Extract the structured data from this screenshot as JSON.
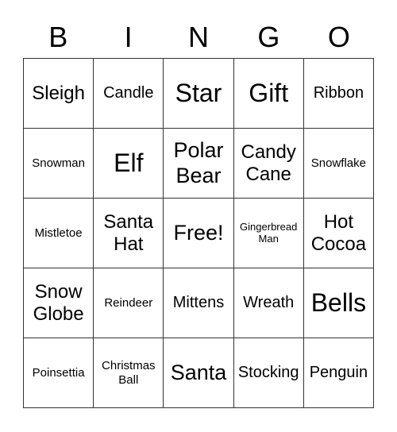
{
  "header": [
    "B",
    "I",
    "N",
    "G",
    "O"
  ],
  "cells": [
    {
      "text": "Sleigh",
      "size": "m"
    },
    {
      "text": "Candle",
      "size": "sm"
    },
    {
      "text": "Star",
      "size": "xl"
    },
    {
      "text": "Gift",
      "size": "xl"
    },
    {
      "text": "Ribbon",
      "size": "sm"
    },
    {
      "text": "Snowman",
      "size": "s"
    },
    {
      "text": "Elf",
      "size": "xl"
    },
    {
      "text": "Polar Bear",
      "size": "l"
    },
    {
      "text": "Candy Cane",
      "size": "m"
    },
    {
      "text": "Snowflake",
      "size": "s"
    },
    {
      "text": "Mistletoe",
      "size": "s"
    },
    {
      "text": "Santa Hat",
      "size": "m"
    },
    {
      "text": "Free!",
      "size": "l"
    },
    {
      "text": "Gingerbread Man",
      "size": "xs"
    },
    {
      "text": "Hot Cocoa",
      "size": "m"
    },
    {
      "text": "Snow Globe",
      "size": "m"
    },
    {
      "text": "Reindeer",
      "size": "s"
    },
    {
      "text": "Mittens",
      "size": "sm"
    },
    {
      "text": "Wreath",
      "size": "sm"
    },
    {
      "text": "Bells",
      "size": "xl"
    },
    {
      "text": "Poinsettia",
      "size": "s"
    },
    {
      "text": "Christmas Ball",
      "size": "s"
    },
    {
      "text": "Santa",
      "size": "l"
    },
    {
      "text": "Stocking",
      "size": "sm"
    },
    {
      "text": "Penguin",
      "size": "sm"
    }
  ]
}
